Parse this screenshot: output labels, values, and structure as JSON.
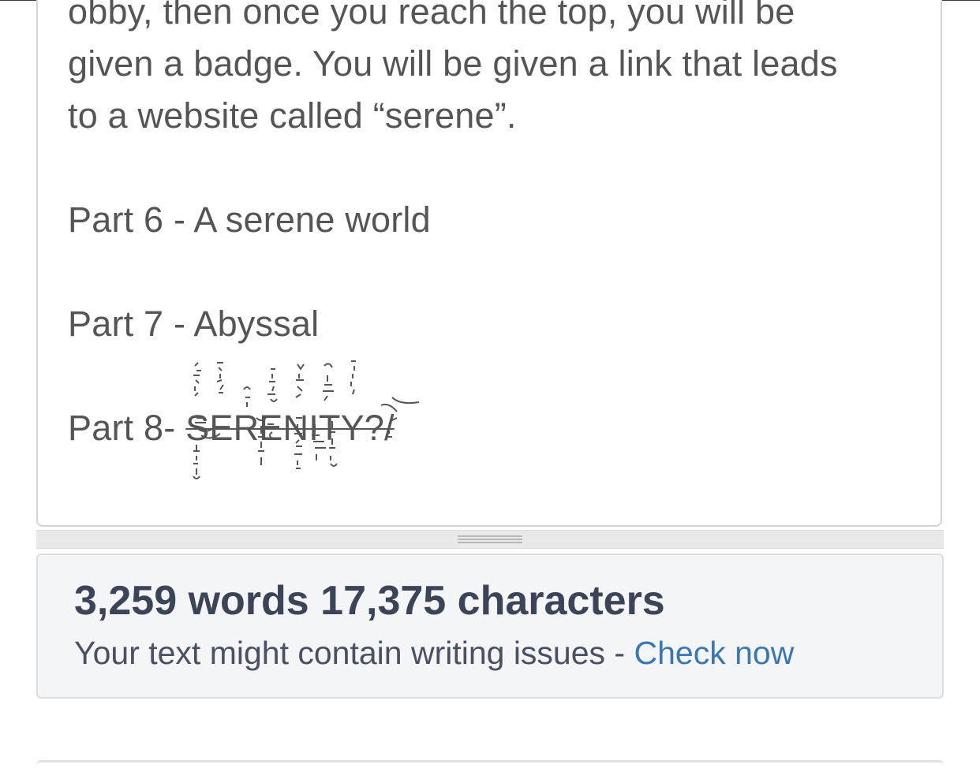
{
  "editor": {
    "lines": [
      "obby, then once you reach the top, you will be",
      "given a badge. You will be given a link that leads",
      "to a website called “serene”."
    ],
    "part6": "Part 6 - A serene world",
    "part7": "Part 7 - Abyssal",
    "part8_prefix": "Part 8- ",
    "part8_title": "SERENITY?/"
  },
  "stats": {
    "count": "3,259 words 17,375 characters",
    "issues_text": "Your text might contain writing issues - ",
    "check_link": "Check now"
  },
  "colors": {
    "body_text": "#555555",
    "stats_heading": "#3b4557",
    "link": "#3d76b0"
  }
}
